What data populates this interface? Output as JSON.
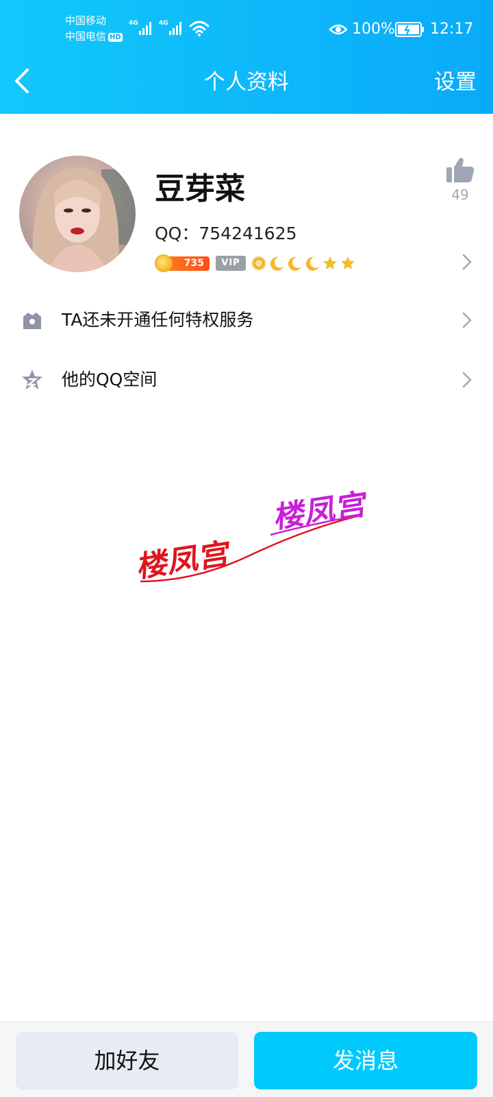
{
  "status_bar": {
    "carrier_1": "中国移动",
    "carrier_2": "中国电信",
    "hd_badge": "HD",
    "network_1": "4G",
    "network_2": "4G",
    "battery_pct": "100%",
    "time": "12:17"
  },
  "header": {
    "back_icon": "chevron-left-icon",
    "title": "个人资料",
    "settings_label": "设置",
    "background": "#0aaaf8"
  },
  "profile": {
    "nickname": "豆芽菜",
    "qq_label": "QQ：",
    "qq_number": "754241625",
    "coin_level": "735",
    "vip_label": "VIP",
    "level_icons": [
      "sun-icon",
      "moon-icon",
      "moon-icon",
      "moon-icon",
      "star-icon",
      "star-icon"
    ],
    "like_count": "49"
  },
  "rows": [
    {
      "icon": "crown-icon",
      "label": "TA还未开通任何特权服务"
    },
    {
      "icon": "qzone-star-icon",
      "label": "他的QQ空间"
    }
  ],
  "watermark": {
    "text_1": "楼凤宫",
    "text_2": "楼凤宫",
    "color_1": "#e0141e",
    "color_2": "#c81fd8"
  },
  "bottom_bar": {
    "add_friend_label": "加好友",
    "send_message_label": "发消息",
    "accent": "#00cafc"
  }
}
